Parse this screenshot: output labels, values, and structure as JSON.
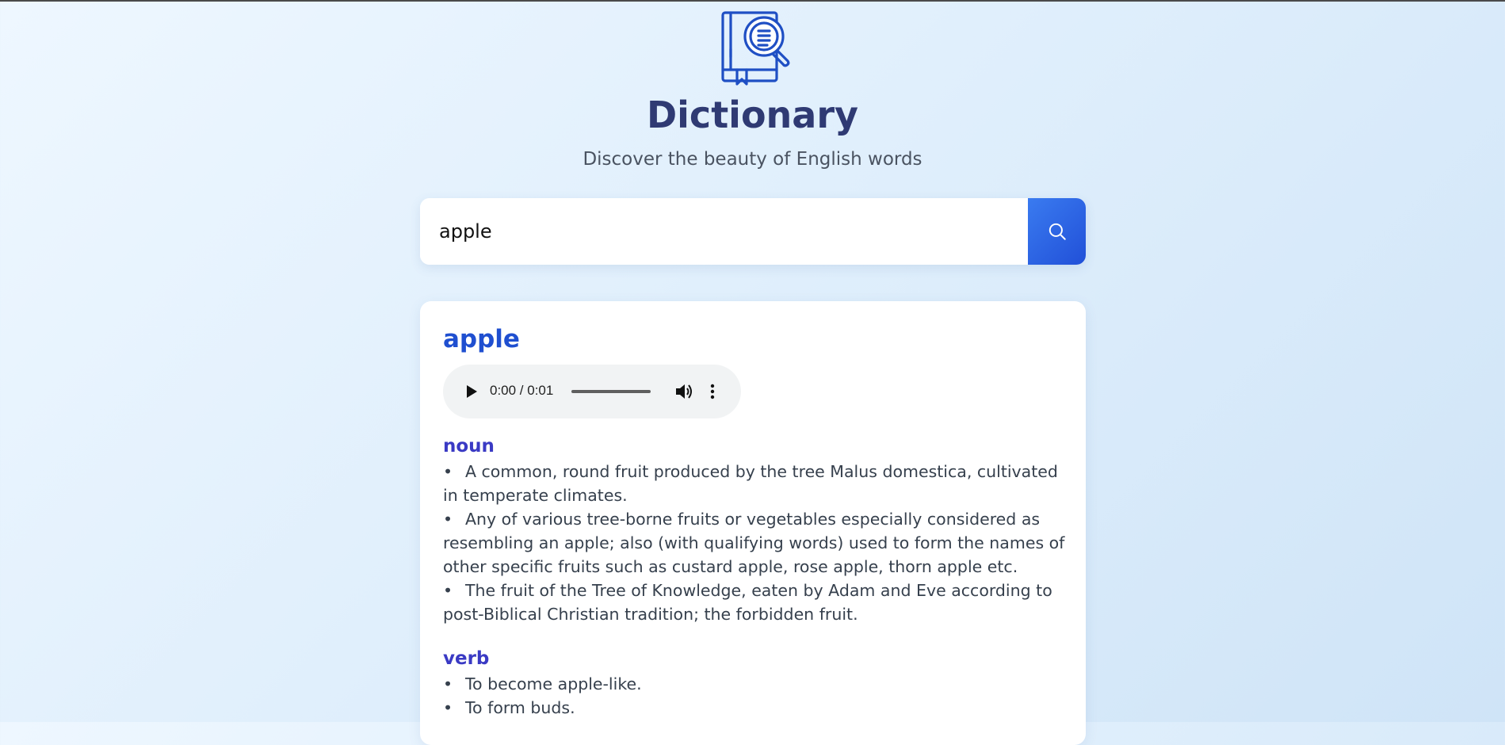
{
  "header": {
    "logo_icon": "dictionary-book-magnifier-icon",
    "title": "Dictionary",
    "subtitle": "Discover the beauty of English words"
  },
  "search": {
    "value": "apple",
    "placeholder": "",
    "button_icon": "search-icon"
  },
  "result": {
    "word": "apple",
    "audio": {
      "time": "0:00 / 0:01",
      "progress": 0
    },
    "meanings": [
      {
        "part_of_speech": "noun",
        "definitions": [
          "A common, round fruit produced by the tree Malus domestica, cultivated in temperate climates.",
          "Any of various tree-borne fruits or vegetables especially considered as resembling an apple; also (with qualifying words) used to form the names of other specific fruits such as custard apple, rose apple, thorn apple etc.",
          "The fruit of the Tree of Knowledge, eaten by Adam and Eve according to post-Biblical Christian tradition; the forbidden fruit."
        ]
      },
      {
        "part_of_speech": "verb",
        "definitions": [
          "To become apple-like.",
          "To form buds."
        ]
      }
    ]
  },
  "colors": {
    "accent": "#2150d8",
    "title": "#2f3a73",
    "part_of_speech": "#3a3ac4",
    "word": "#1f4fd0"
  }
}
